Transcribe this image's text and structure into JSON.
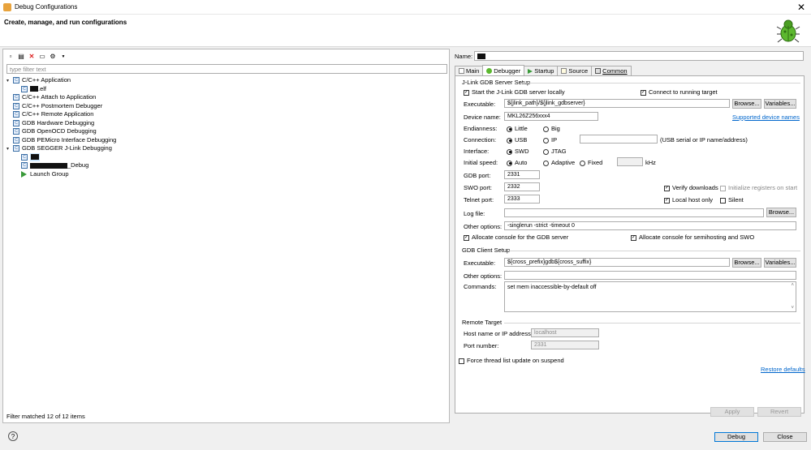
{
  "window": {
    "title": "Debug Configurations"
  },
  "header": {
    "heading": "Create, manage, and run configurations"
  },
  "filter": {
    "placeholder": "type filter text"
  },
  "tree": {
    "cpp_app": "C/C++ Application",
    "cpp_app_child": ".elf",
    "attach": "C/C++ Attach to Application",
    "postmortem": "C/C++ Postmortem Debugger",
    "remote": "C/C++ Remote Application",
    "gdb_hw": "GDB Hardware Debugging",
    "gdb_ocd": "GDB OpenOCD Debugging",
    "gdb_pemicro": "GDB PEMicro Interface Debugging",
    "gdb_segger": "GDB SEGGER J-Link Debugging",
    "segger_child2": "_Debug",
    "launch_group": "Launch Group"
  },
  "status": "Filter matched 12 of 12 items",
  "name_label": "Name:",
  "tabs": [
    "Main",
    "Debugger",
    "Startup",
    "Source",
    "Common"
  ],
  "server": {
    "group": "J-Link GDB Server Setup",
    "start_locally": "Start the J-Link GDB server locally",
    "connect_running": "Connect to running target",
    "executable_label": "Executable:",
    "executable_value": "${jlink_path}/${jlink_gdbserver}",
    "browse": "Browse...",
    "variables": "Variables...",
    "device_label": "Device name:",
    "device_value": "MKL26Z256xxx4",
    "supported_devices": "Supported device names",
    "endianness_label": "Endianness:",
    "little": "Little",
    "big": "Big",
    "connection_label": "Connection:",
    "usb": "USB",
    "ip": "IP",
    "serial_hint": "(USB serial or IP name/address)",
    "interface_label": "Interface:",
    "swd": "SWD",
    "jtag": "JTAG",
    "speed_label": "Initial speed:",
    "auto": "Auto",
    "adaptive": "Adaptive",
    "fixed": "Fixed",
    "khz": "kHz",
    "gdb_port_label": "GDB port:",
    "gdb_port": "2331",
    "swo_port_label": "SWO port:",
    "swo_port": "2332",
    "telnet_port_label": "Telnet port:",
    "telnet_port": "2333",
    "verify_downloads": "Verify downloads",
    "init_registers": "Initialize registers on start",
    "local_host_only": "Local host only",
    "silent": "Silent",
    "log_label": "Log file:",
    "other_label": "Other options:",
    "other_value": "-singlerun -strict -timeout 0",
    "alloc_console_server": "Allocate console for the GDB server",
    "alloc_console_semihost": "Allocate console for semihosting and SWO"
  },
  "client": {
    "group": "GDB Client Setup",
    "executable_label": "Executable:",
    "executable_value": "${cross_prefix}gdb${cross_suffix}",
    "browse": "Browse...",
    "variables": "Variables...",
    "other_label": "Other options:",
    "commands_label": "Commands:",
    "commands_value": "set mem inaccessible-by-default off"
  },
  "remote": {
    "group": "Remote Target",
    "host_label": "Host name or IP address:",
    "host_value": "localhost",
    "port_label": "Port number:",
    "port_value": "2331"
  },
  "force_thread": "Force thread list update on suspend",
  "restore_defaults": "Restore defaults",
  "apply": "Apply",
  "revert": "Revert",
  "debug": "Debug",
  "close": "Close"
}
